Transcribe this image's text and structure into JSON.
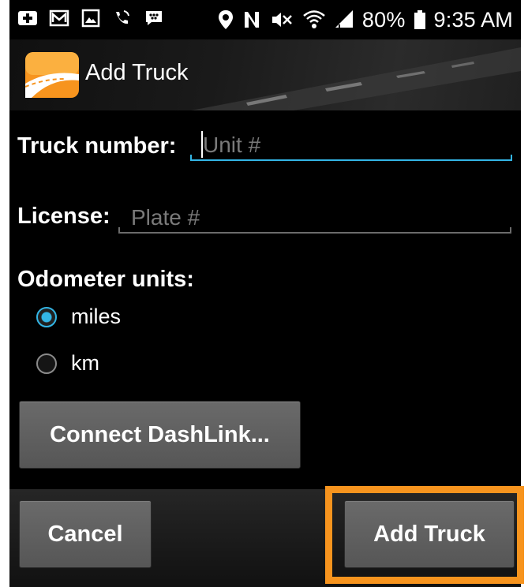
{
  "status_bar": {
    "battery": "80%",
    "time": "9:35 AM",
    "icons": [
      "plus-box-icon",
      "gmail-icon",
      "image-icon",
      "voicemail-icon",
      "blackberry-icon",
      "location-icon",
      "nfc-icon",
      "mute-icon",
      "wifi-icon",
      "signal-icon",
      "battery-icon"
    ]
  },
  "action_bar": {
    "title": "Add Truck",
    "logo": "road-logo-icon"
  },
  "form": {
    "truck_number_label": "Truck number:",
    "truck_number_placeholder": "Unit #",
    "license_label": "License:",
    "license_placeholder": "Plate #",
    "odometer_label": "Odometer units:",
    "odometer_options": [
      {
        "label": "miles",
        "checked": true
      },
      {
        "label": "km",
        "checked": false
      }
    ],
    "connect_button": "Connect DashLink..."
  },
  "footer": {
    "cancel_button": "Cancel",
    "add_button": "Add Truck"
  },
  "colors": {
    "accent": "#33b5e5",
    "highlight": "#f7941e",
    "logo_orange": "#f7941e"
  }
}
